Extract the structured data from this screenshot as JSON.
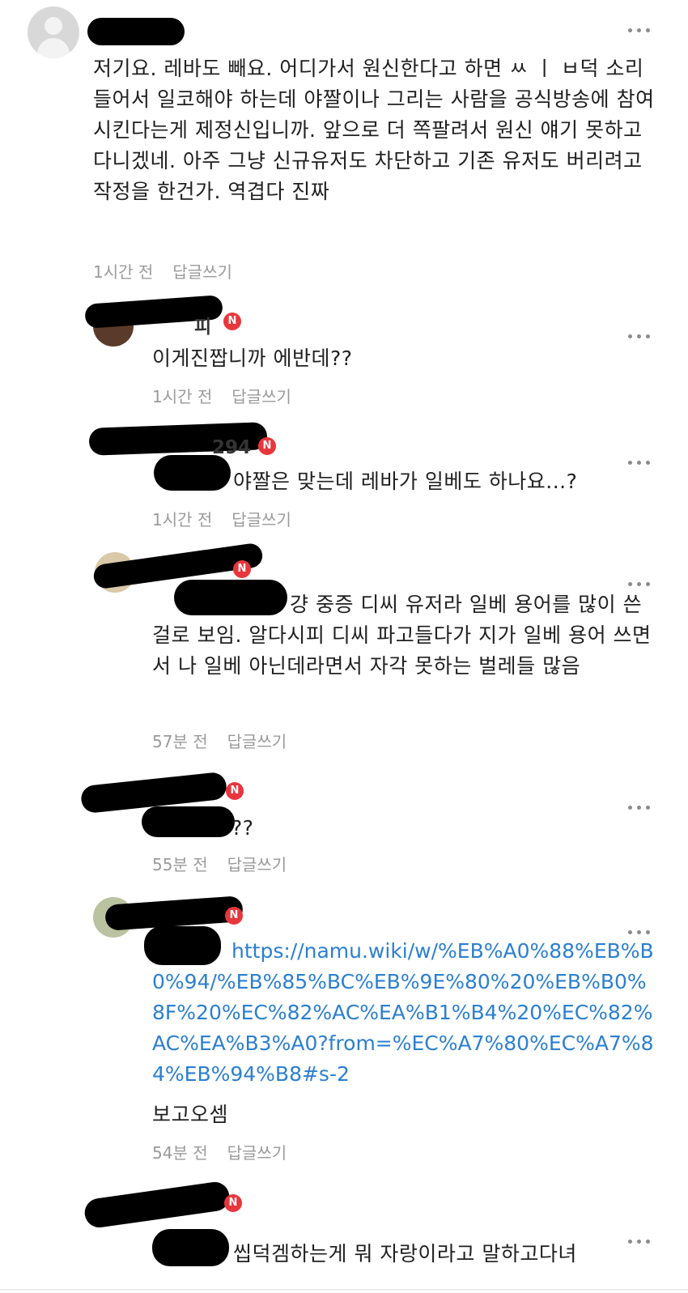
{
  "comments": [
    {
      "text": "저기요. 레바도 빼요. 어디가서 원신한다고 하면 ㅆ ㅣ ㅂ덕 소리 들어서 일코해야 하는데 야짤이나 그리는 사람을 공식방송에 참여시킨다는게 제정신입니까. 앞으로 더 쪽팔려서 원신 얘기 못하고 다니겠네. 아주 그냥 신규유저도 차단하고 기존 유저도 버리려고 작정을 한건가. 역겹다 진짜",
      "time": "1시간 전",
      "reply": "답글쓰기"
    },
    {
      "name_fragment": "피",
      "text": "이게진짭니까 에반데??",
      "time": "1시간 전",
      "reply": "답글쓰기"
    },
    {
      "name_fragment": "294",
      "text": "야짤은 맞는데 레바가 일베도 하나요...?",
      "time": "1시간 전",
      "reply": "답글쓰기"
    },
    {
      "text": "걍 중증 디씨 유저라 일베 용어를 많이 쓴 걸로 보임. 알다시피 디씨 파고들다가 지가 일베 용어 쓰면서 나 일베 아닌데라면서 자각 못하는 벌레들 많음",
      "time": "57분 전",
      "reply": "답글쓰기"
    },
    {
      "text": "??",
      "time": "55분 전",
      "reply": "답글쓰기"
    },
    {
      "link": "https://namu.wiki/w/%EB%A0%88%EB%B0%94/%EB%85%BC%EB%9E%80%20%EB%B0%8F%20%EC%82%AC%EA%B1%B4%20%EC%82%AC%EA%B3%A0?from=%EC%A7%80%EC%A7%84%EB%94%B8#s-2",
      "text": "보고오셈",
      "time": "54분 전",
      "reply": "답글쓰기"
    },
    {
      "text": "씹덕겜하는게 뭐 자랑이라고 말하고다녀"
    }
  ],
  "badge": "N",
  "colors": {
    "badge": "#e8363d",
    "link": "#2b7fd0",
    "meta": "#9a9a9a"
  },
  "icons": {
    "more": "more-vertical-dots-icon",
    "avatar": "user-silhouette-icon"
  }
}
